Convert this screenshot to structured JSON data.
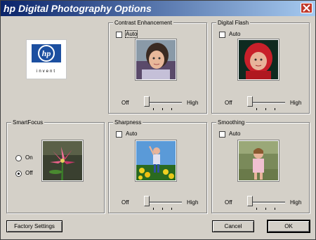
{
  "window": {
    "title": "hp Digital Photography Options",
    "close_icon": "close-icon"
  },
  "logo": {
    "mark": "hp",
    "tagline": "invent",
    "brand_color": "#1c4fa0"
  },
  "panels": {
    "contrast": {
      "title": "Contrast Enhancement",
      "auto_label": "Auto",
      "auto_checked": false,
      "slider_min_label": "Off",
      "slider_max_label": "High",
      "slider_value": 0
    },
    "flash": {
      "title": "Digital Flash",
      "auto_label": "Auto",
      "auto_checked": false,
      "slider_min_label": "Off",
      "slider_max_label": "High",
      "slider_value": 0
    },
    "smartfocus": {
      "title": "SmartFocus",
      "on_label": "On",
      "off_label": "Off",
      "selected": "Off"
    },
    "sharpness": {
      "title": "Sharpness",
      "auto_label": "Auto",
      "auto_checked": false,
      "slider_min_label": "Off",
      "slider_max_label": "High",
      "slider_value": 0
    },
    "smoothing": {
      "title": "Smoothing",
      "auto_label": "Auto",
      "auto_checked": false,
      "slider_min_label": "Off",
      "slider_max_label": "High",
      "slider_value": 0
    }
  },
  "buttons": {
    "factory": "Factory Settings",
    "cancel": "Cancel",
    "ok": "OK"
  },
  "colors": {
    "title_bar_start": "#0a246a",
    "title_bar_end": "#a6caf0",
    "dialog_bg": "#d4d0c8",
    "close_button": "#c0392b"
  }
}
